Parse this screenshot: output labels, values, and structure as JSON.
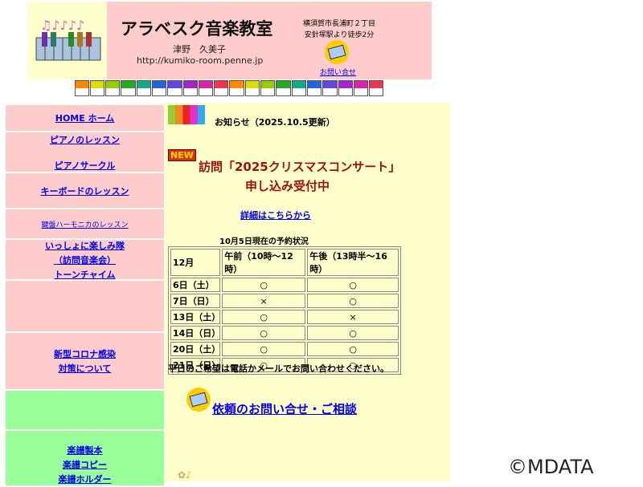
{
  "header": {
    "title": "アラベスク音楽教室",
    "owner": "津野　久美子",
    "url": "http://kumiko-room.penne.jp",
    "address": "横須賀市長浦町２丁目",
    "access": "安針塚駅より徒歩2分",
    "contact_link": "お問い合せ"
  },
  "sidebar": {
    "items": [
      {
        "lines": [
          "HOME ホーム"
        ]
      },
      {
        "lines": [
          "ピアノのレッスン",
          "ピアノサークル"
        ]
      },
      {
        "lines": [
          "キーボードのレッスン"
        ]
      },
      {
        "lines": [
          "鍵盤ハーモニカのレッスン"
        ]
      },
      {
        "lines": [
          "いっしょに楽しみ隊",
          "（訪問音楽会）",
          "トーンチャイム"
        ]
      },
      {
        "lines": []
      },
      {
        "lines": [
          "新型コロナ感染",
          "対策について"
        ]
      },
      {
        "lines": []
      },
      {
        "lines": [
          "楽譜製本",
          "楽譜コピー",
          "楽譜ホルダー"
        ]
      }
    ]
  },
  "main": {
    "notice": "お知らせ（2025.10.5更新）",
    "new_badge": "NEW",
    "headline1": "訪問「2025クリスマスコンサート」",
    "headline2": "申し込み受付中",
    "details_link": "詳細はこちらから",
    "table_caption": "10月5日現在の予約状況",
    "table": {
      "headers": [
        "12月",
        "午前（10時～12時）",
        "午後（13時半～16時）"
      ],
      "rows": [
        [
          "6日（土）",
          "○",
          "○"
        ],
        [
          "7日（日）",
          "×",
          "○"
        ],
        [
          "13日（土）",
          "○",
          "×"
        ],
        [
          "14日（日）",
          "○",
          "○"
        ],
        [
          "20日（土）",
          "○",
          "○"
        ],
        [
          "21日（日）",
          "○",
          "○"
        ]
      ]
    },
    "weekday_note": "平日のご希望は電話かメールでお問い合わせください。",
    "inquiry_link": "依頼のお問い合せ・ご相談"
  },
  "watermark": "©MDATA"
}
